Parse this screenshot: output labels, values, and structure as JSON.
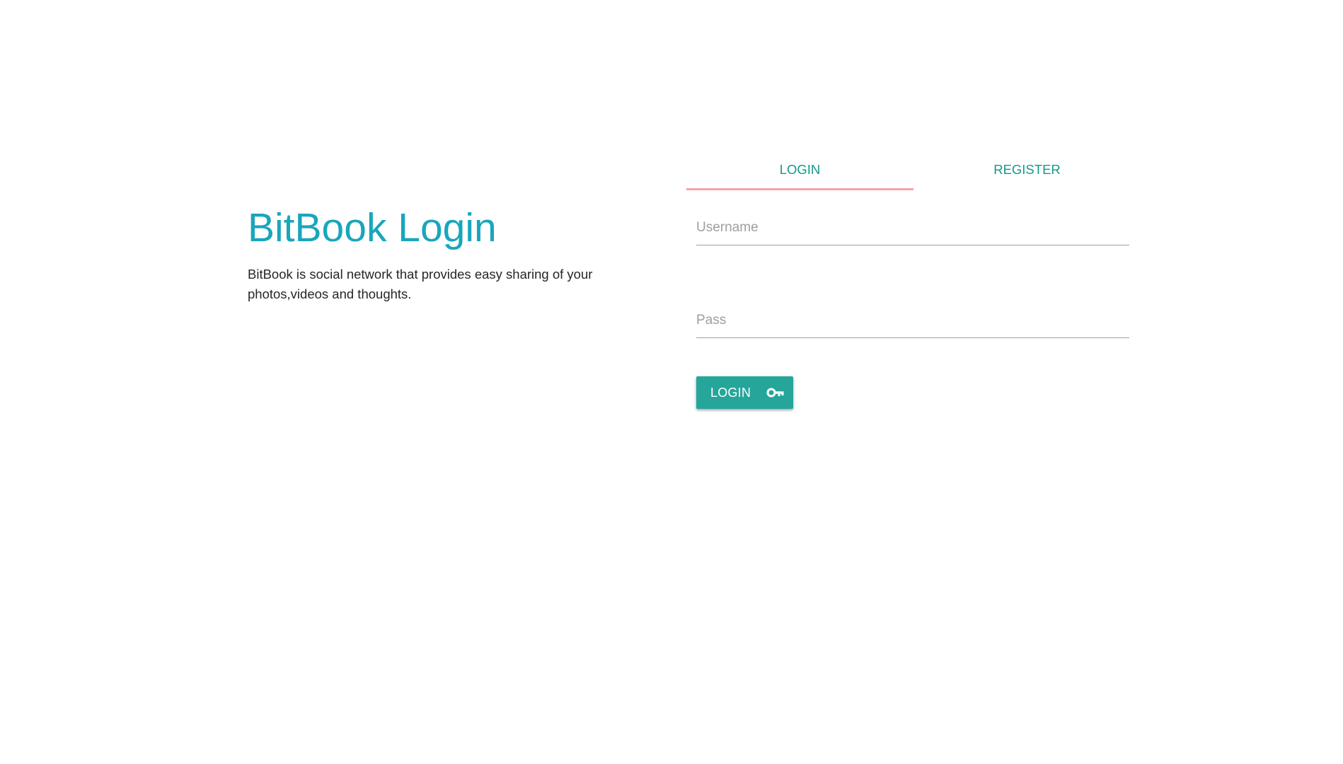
{
  "intro": {
    "title": "BitBook Login",
    "description": "BitBook is social network that provides easy sharing of your photos,videos and thoughts."
  },
  "tabs": [
    {
      "label": "LOGIN",
      "active": true
    },
    {
      "label": "REGISTER",
      "active": false
    }
  ],
  "form": {
    "username": {
      "placeholder": "Username",
      "value": ""
    },
    "password": {
      "placeholder": "Pass",
      "value": ""
    },
    "submit_label": "LOGIN",
    "submit_icon": "key-icon"
  },
  "colors": {
    "title": "#19a6bb",
    "tab_text": "#12998a",
    "tab_indicator": "#f5a3ab",
    "button": "#26a69a"
  }
}
